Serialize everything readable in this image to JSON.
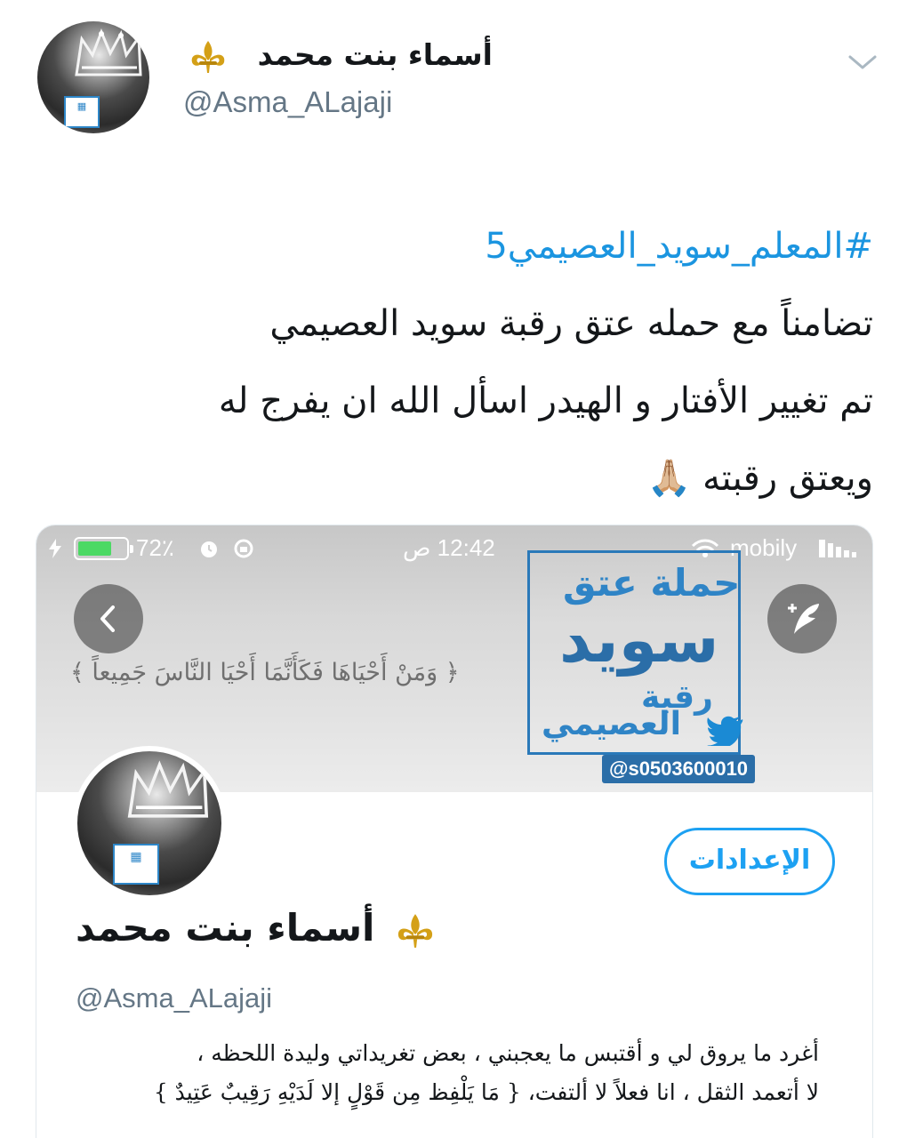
{
  "tweet": {
    "display_name": "أسماء بنت محمد",
    "handle": "@Asma_ALajaji",
    "hashtag": "#المعلم_سويد_العصيمي5",
    "lines": [
      "تضامناً مع حمله عتق رقبة سويد العصيمي",
      "تم تغيير الأفتار و الهيدر اسأل الله ان يفرج له",
      "ويعتق رقبته"
    ],
    "emoji": "🙏🏼"
  },
  "icons": {
    "fleur": "fleur-de-lis-icon",
    "chevron": "chevron-down-icon",
    "back": "back-icon",
    "compose": "compose-tweet-icon",
    "twitter_bird": "twitter-bird-icon"
  },
  "screenshot": {
    "status_bar": {
      "battery": "72٪",
      "battery_level": 0.72,
      "time": "12:42 ص",
      "carrier": "mobily"
    },
    "banner": {
      "quote": "﴿ وَمَنْ أَحْيَاهَا فَكَأَنَّمَا أَحْيَا النَّاسَ جَمِيعاً ﴾",
      "logo_line1": "حملة عتق",
      "logo_line2": "سويد",
      "logo_line3": "رقبة",
      "logo_line4": "العصيمي",
      "logo_handle": "@s0503600010"
    },
    "settings_label": "الإعدادات",
    "profile_name": "أسماء بنت محمد",
    "profile_handle": "@Asma_ALajaji",
    "bio": [
      "أغرد ما يروق لي و أقتبس ما يعجبني ، بعض تغريداتي وليدة اللحظه ،",
      "لا أتعمد الثقل ، انا فعلاً لا ألتفت، { مَا يَلْفِظ مِن قَوْلٍ إلا لَدَيْهِ رَقِيبٌ عَتِيدٌ }"
    ]
  },
  "colors": {
    "link": "#1b95e0",
    "brand_blue": "#1da1f2",
    "gold": "#d4a017"
  }
}
